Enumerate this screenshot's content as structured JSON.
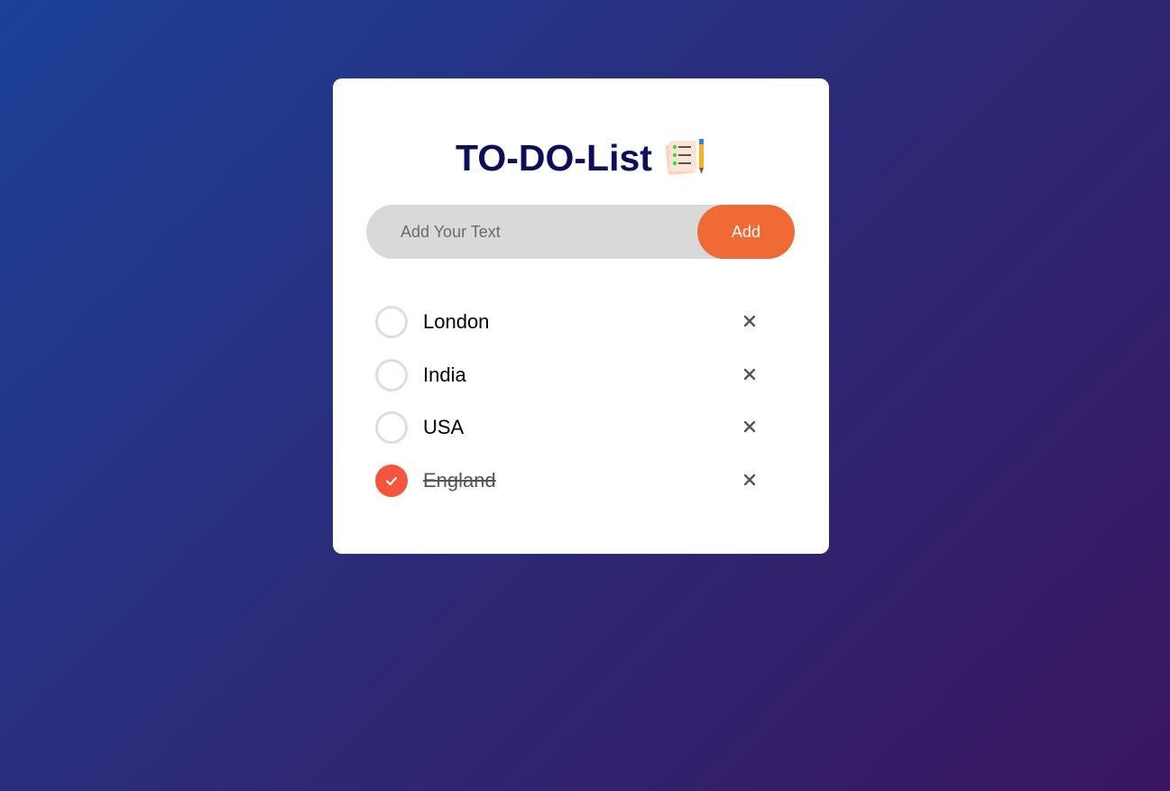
{
  "app": {
    "title": "TO-DO-List",
    "title_icon": "notepad-pencil-icon"
  },
  "input": {
    "placeholder": "Add Your Text",
    "value": ""
  },
  "add_button": {
    "label": "Add"
  },
  "todos": [
    {
      "text": "London",
      "checked": false
    },
    {
      "text": "India",
      "checked": false
    },
    {
      "text": "USA",
      "checked": false
    },
    {
      "text": "England",
      "checked": true
    }
  ],
  "icons": {
    "remove": "close-icon",
    "checked": "checkmark-icon"
  },
  "colors": {
    "accent": "#f06a35",
    "checked_fill": "#f4563d",
    "title": "#0c0e5c",
    "input_bg": "#d9d9d9"
  }
}
